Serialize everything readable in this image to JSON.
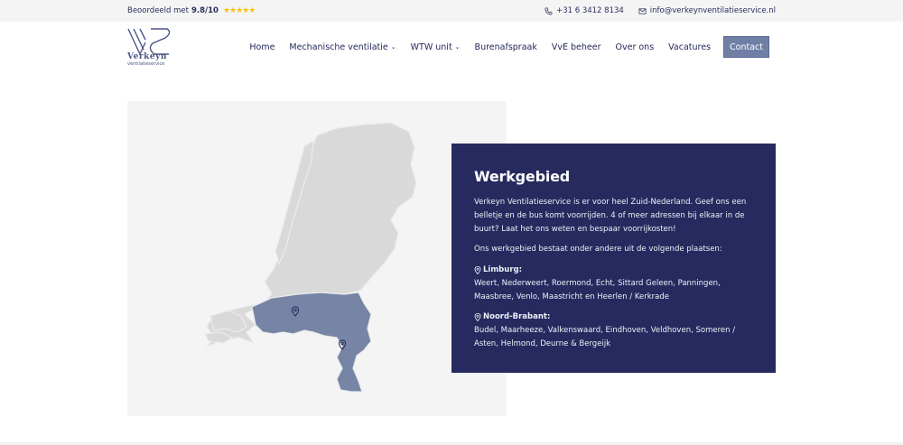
{
  "topbar": {
    "rating_prefix": "Beoordeeld met",
    "rating_value": "9.8/10",
    "stars": "★★★★★",
    "phone": "+31 6 3412 8134",
    "email": "info@verkeynventilatieservice.nl"
  },
  "logo": {
    "name": "Verkeyn",
    "tagline": "ventilatieservice"
  },
  "nav": {
    "items": [
      {
        "label": "Home"
      },
      {
        "label": "Mechanische ventilatie"
      },
      {
        "label": "WTW unit"
      },
      {
        "label": "Burenafspraak"
      },
      {
        "label": "VvE beheer"
      },
      {
        "label": "Over ons"
      },
      {
        "label": "Vacatures"
      }
    ],
    "cta": "Contact"
  },
  "card": {
    "title": "Werkgebied",
    "intro": "Verkeyn Ventilatieservice is er voor heel Zuid-Nederland. Geef ons een belletje en de bus komt voorrijden. 4 of meer adressen bij elkaar in de buurt? Laat het ons weten en bespaar voorrijkosten!",
    "places_intro": "Ons werkgebied bestaat onder andere uit de volgende plaatsen:",
    "regions": [
      {
        "name": "Limburg:",
        "places": "Weert, Nederweert, Roermond, Echt, Sittard Geleen, Panningen, Maasbree, Venlo, Maastricht en Heerlen / Kerkrade"
      },
      {
        "name": "Noord-Brabant:",
        "places": "Budel, Maarheeze, Valkenswaard, Eindhoven, Veldhoven, Someren / Asten, Helmond, Deurne & Bergeijk"
      }
    ]
  },
  "colors": {
    "accent": "#262a5e",
    "map_land": "#d9d9d9",
    "map_highlight": "#7685a6",
    "star": "#f3c317"
  }
}
